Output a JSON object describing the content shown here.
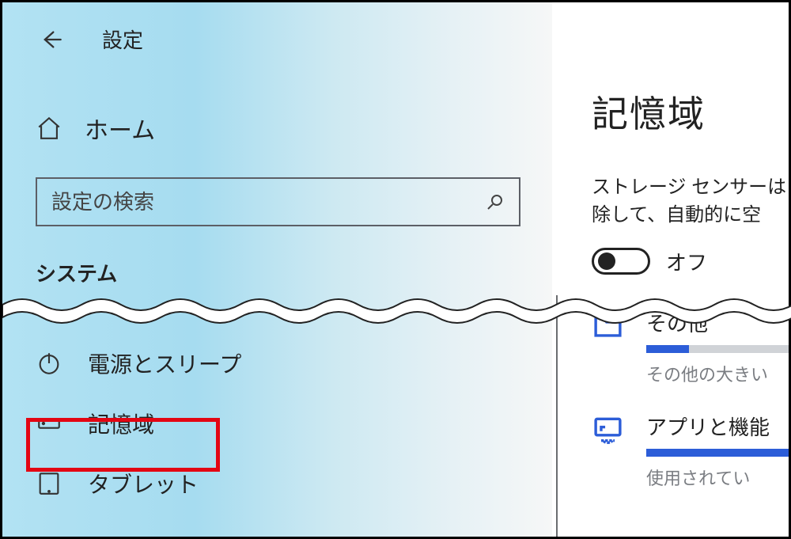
{
  "header": {
    "title": "設定"
  },
  "sidebar": {
    "home_label": "ホーム",
    "search_placeholder": "設定の検索",
    "section_label": "システム",
    "items": [
      {
        "label": "電源とスリープ",
        "icon": "power-icon"
      },
      {
        "label": "記憶域",
        "icon": "storage-icon"
      },
      {
        "label": "タブレット",
        "icon": "tablet-icon"
      }
    ]
  },
  "main": {
    "page_title": "記憶域",
    "description_line1": "ストレージ センサーは",
    "description_line2": "除して、自動的に空",
    "toggle": {
      "state": "off",
      "label": "オフ"
    },
    "categories": [
      {
        "title": "その他",
        "sub": "その他の大きい",
        "fill_pct": 30
      },
      {
        "title": "アプリと機能",
        "sub": "使用されてい",
        "fill_pct": 100
      }
    ]
  }
}
